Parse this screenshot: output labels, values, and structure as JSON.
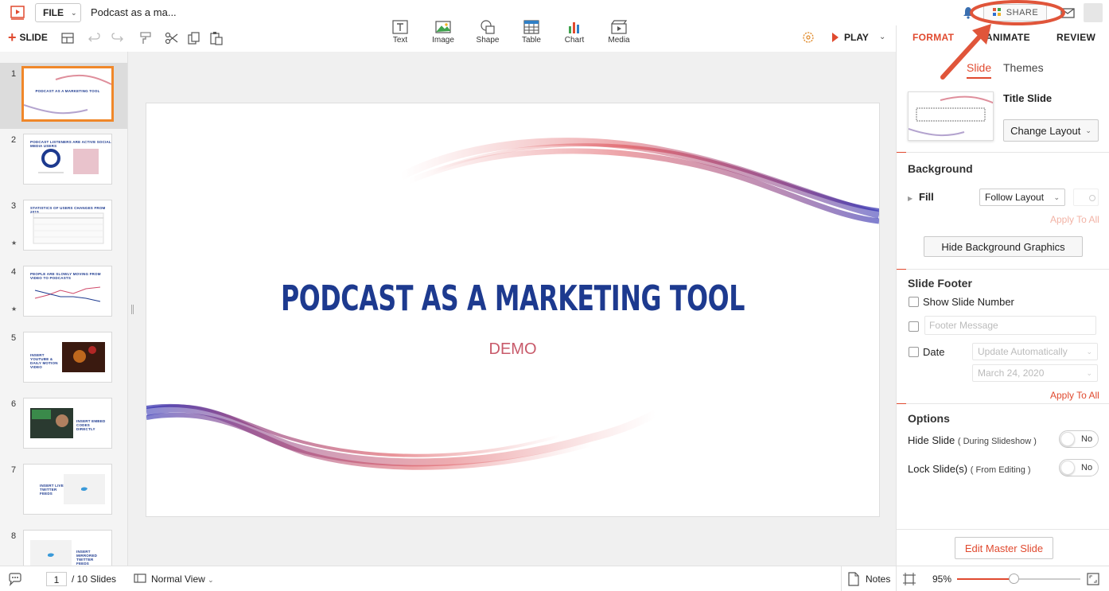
{
  "app": {
    "doc_title": "Podcast as a ma...",
    "file_label": "FILE",
    "share_label": "SHARE",
    "accent_color": "#e04a2f"
  },
  "toolbar": {
    "slide_label": "SLIDE",
    "insert_items": [
      {
        "label": "Text",
        "icon": "text-box-icon"
      },
      {
        "label": "Image",
        "icon": "image-icon"
      },
      {
        "label": "Shape",
        "icon": "shape-icon"
      },
      {
        "label": "Table",
        "icon": "table-icon"
      },
      {
        "label": "Chart",
        "icon": "chart-icon"
      },
      {
        "label": "Media",
        "icon": "media-icon"
      }
    ],
    "play_label": "PLAY"
  },
  "right_tabs": [
    {
      "label": "FORMAT",
      "active": true
    },
    {
      "label": "ANIMATE",
      "active": false
    },
    {
      "label": "REVIEW",
      "active": false
    }
  ],
  "thumbnails": [
    {
      "num": "1",
      "title": "PODCAST AS A MARKETING TOOL",
      "selected": true
    },
    {
      "num": "2",
      "title": "PODCAST LISTENERS ARE ACTIVE SOCIAL MEDIA USERS"
    },
    {
      "num": "3",
      "title": "STATISTICS OF USERS CHANGES FROM 2019"
    },
    {
      "num": "4",
      "title": "PEOPLE ARE SLOWLY MOVING FROM VIDEO TO PODCASTS"
    },
    {
      "num": "5",
      "title": "INSERT YOUTUBE & DAILY MOTION VIDEO"
    },
    {
      "num": "6",
      "title": "INSERT EMBED CODES DIRECTLY"
    },
    {
      "num": "7",
      "title": "INSERT LIVE TWITTER FEEDS"
    },
    {
      "num": "8",
      "title": "INSERT MIRRORED TWITTER FEEDS"
    }
  ],
  "slide": {
    "title": "PODCAST AS A MARKETING TOOL",
    "subtitle": "DEMO"
  },
  "panel": {
    "subtabs": [
      "Slide",
      "Themes"
    ],
    "layout_name": "Title Slide",
    "change_layout": "Change Layout",
    "background_title": "Background",
    "fill_label": "Fill",
    "fill_value": "Follow Layout",
    "apply_to_all": "Apply To All",
    "hide_bg_graphics": "Hide Background Graphics",
    "footer_title": "Slide Footer",
    "show_slide_number": "Show Slide Number",
    "footer_message_placeholder": "Footer Message",
    "date_label": "Date",
    "date_mode": "Update Automatically",
    "date_value": "March 24, 2020",
    "options_title": "Options",
    "hide_slide": "Hide Slide",
    "hide_slide_note": "( During Slideshow )",
    "lock_slide": "Lock Slide(s)",
    "lock_slide_note": "( From Editing )",
    "toggle_value": "No",
    "edit_master": "Edit Master Slide"
  },
  "status": {
    "current_page": "1",
    "total": "/ 10 Slides",
    "view": "Normal View",
    "notes": "Notes",
    "zoom": "95%",
    "zoom_level": 0.46
  }
}
